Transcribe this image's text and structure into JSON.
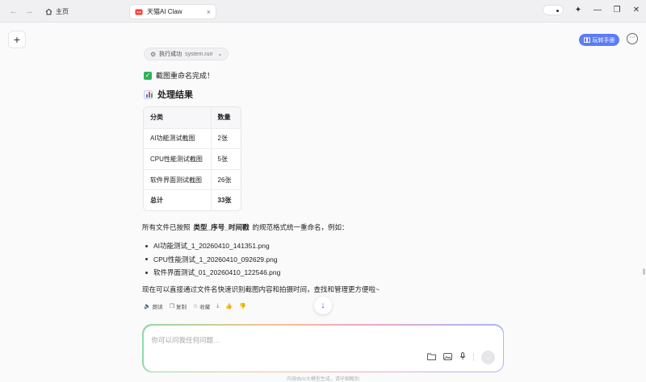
{
  "titlebar": {
    "back_icon": "arrow-left-icon",
    "forward_icon": "arrow-right-icon",
    "home_label": "主页",
    "active_tab_label": "天猫AI Claw",
    "close_symbol": "×"
  },
  "toolbar": {
    "manual_label": "玩转手册"
  },
  "chat": {
    "tool_status": "执行成功",
    "tool_command": "system.run",
    "done_text": "截图重命名完成！",
    "section_title": "处理结果",
    "table": {
      "headers": [
        "分类",
        "数量"
      ],
      "rows": [
        [
          "AI功能测试截图",
          "2张"
        ],
        [
          "CPU性能测试截图",
          "5张"
        ],
        [
          "软件界面测试截图",
          "26张"
        ]
      ],
      "total": [
        "总计",
        "33张"
      ]
    },
    "para_prefix": "所有文件已按照",
    "para_highlight": "类型_序号_时间戳",
    "para_suffix": "的规范格式统一重命名，例如：",
    "files": [
      "AI功能测试_1_20260410_141351.png",
      "CPU性能测试_1_20260410_092629.png",
      "软件界面测试_01_20260410_122546.png"
    ],
    "closing": "现在可以直接通过文件名快速识别截图内容和拍摄时间，查找和管理更方便啦~",
    "actions": {
      "read": "朗读",
      "copy": "复制",
      "favorite": "收藏"
    }
  },
  "input": {
    "placeholder": "你可以问我任何问题…"
  },
  "footer": {
    "disclaimer": "内容由AI大模型生成，请仔细甄别"
  },
  "colors": {
    "accent": "#5b7cf5",
    "check": "#2fb257"
  }
}
